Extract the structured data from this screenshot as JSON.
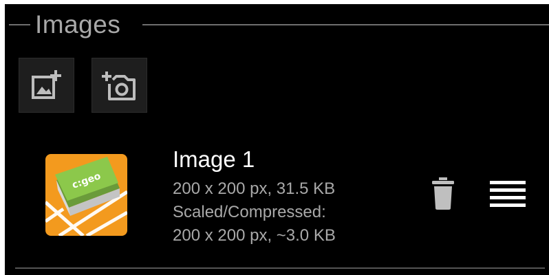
{
  "section": {
    "title": "Images"
  },
  "toolbar": {
    "buttons": [
      {
        "icon": "add-photo-icon"
      },
      {
        "icon": "add-camera-icon"
      }
    ]
  },
  "images": [
    {
      "title": "Image 1",
      "size_line": "200 x 200 px, 31.5 KB",
      "scaled_label": "Scaled/Compressed:",
      "scaled_line": "200 x 200 px, ~3.0 KB",
      "thumbnail_label": "c:geo",
      "actions": {
        "delete_icon": "trash-icon",
        "drag_icon": "drag-handle-icon"
      }
    }
  ],
  "colors": {
    "background": "#000000",
    "header_line": "#6f6f6f",
    "title_text": "#ffffff",
    "secondary_text": "#a9a9a9",
    "thumbnail_orange": "#f39a1e",
    "thumbnail_green": "#7fbf3f"
  }
}
